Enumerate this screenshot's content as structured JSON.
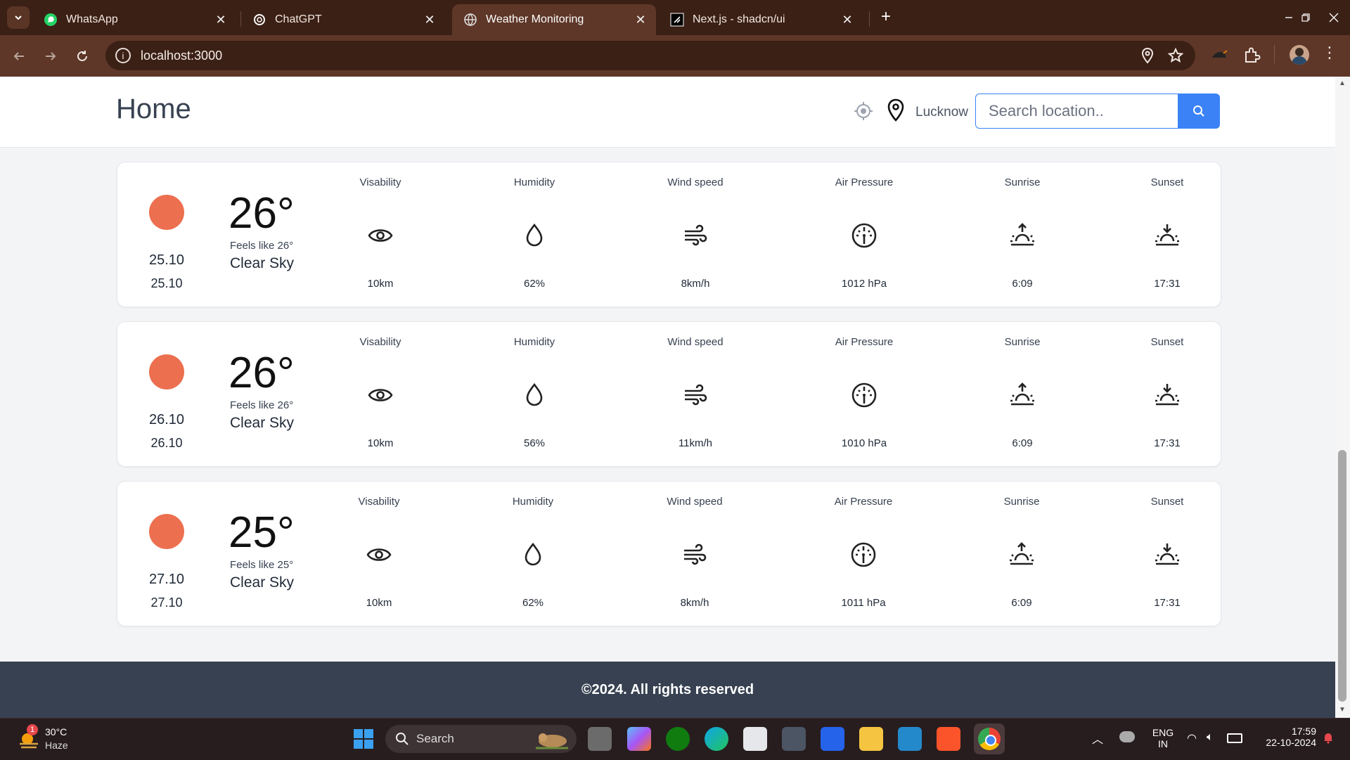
{
  "browser": {
    "tabs": [
      {
        "title": "WhatsApp",
        "icon": "whatsapp-icon"
      },
      {
        "title": "ChatGPT",
        "icon": "chatgpt-icon"
      },
      {
        "title": "Weather Monitoring",
        "icon": "globe-icon",
        "active": true
      },
      {
        "title": "Next.js - shadcn/ui",
        "icon": "shadcn-icon"
      }
    ],
    "url": "localhost:3000"
  },
  "header": {
    "title": "Home",
    "location": "Lucknow",
    "search_placeholder": "Search location.."
  },
  "forecast": [
    {
      "date_primary": "25.10",
      "date_secondary": "25.10",
      "temp": "26°",
      "feels_like": "Feels like 26°",
      "description": "Clear Sky",
      "metrics": [
        {
          "label": "Visability",
          "value": "10km",
          "icon": "eye-icon"
        },
        {
          "label": "Humidity",
          "value": "62%",
          "icon": "droplet-icon"
        },
        {
          "label": "Wind speed",
          "value": "8km/h",
          "icon": "wind-icon"
        },
        {
          "label": "Air Pressure",
          "value": "1012 hPa",
          "icon": "gauge-icon"
        },
        {
          "label": "Sunrise",
          "value": "6:09",
          "icon": "sunrise-icon"
        },
        {
          "label": "Sunset",
          "value": "17:31",
          "icon": "sunset-icon"
        }
      ]
    },
    {
      "date_primary": "26.10",
      "date_secondary": "26.10",
      "temp": "26°",
      "feels_like": "Feels like 26°",
      "description": "Clear Sky",
      "metrics": [
        {
          "label": "Visability",
          "value": "10km",
          "icon": "eye-icon"
        },
        {
          "label": "Humidity",
          "value": "56%",
          "icon": "droplet-icon"
        },
        {
          "label": "Wind speed",
          "value": "11km/h",
          "icon": "wind-icon"
        },
        {
          "label": "Air Pressure",
          "value": "1010 hPa",
          "icon": "gauge-icon"
        },
        {
          "label": "Sunrise",
          "value": "6:09",
          "icon": "sunrise-icon"
        },
        {
          "label": "Sunset",
          "value": "17:31",
          "icon": "sunset-icon"
        }
      ]
    },
    {
      "date_primary": "27.10",
      "date_secondary": "27.10",
      "temp": "25°",
      "feels_like": "Feels like 25°",
      "description": "Clear Sky",
      "metrics": [
        {
          "label": "Visability",
          "value": "10km",
          "icon": "eye-icon"
        },
        {
          "label": "Humidity",
          "value": "62%",
          "icon": "droplet-icon"
        },
        {
          "label": "Wind speed",
          "value": "8km/h",
          "icon": "wind-icon"
        },
        {
          "label": "Air Pressure",
          "value": "1011 hPa",
          "icon": "gauge-icon"
        },
        {
          "label": "Sunrise",
          "value": "6:09",
          "icon": "sunrise-icon"
        },
        {
          "label": "Sunset",
          "value": "17:31",
          "icon": "sunset-icon"
        }
      ]
    }
  ],
  "footer": {
    "text": "©2024. All rights reserved"
  },
  "taskbar": {
    "weather_temp": "30°C",
    "weather_desc": "Haze",
    "notification_count": "1",
    "search_label": "Search",
    "lang_top": "ENG",
    "lang_bottom": "IN",
    "time": "17:59",
    "date": "22-10-2024"
  },
  "colors": {
    "accent": "#3b82f6",
    "sun": "#ec6f4f",
    "footer_bg": "#374151",
    "browser_frame": "#3b2015"
  }
}
